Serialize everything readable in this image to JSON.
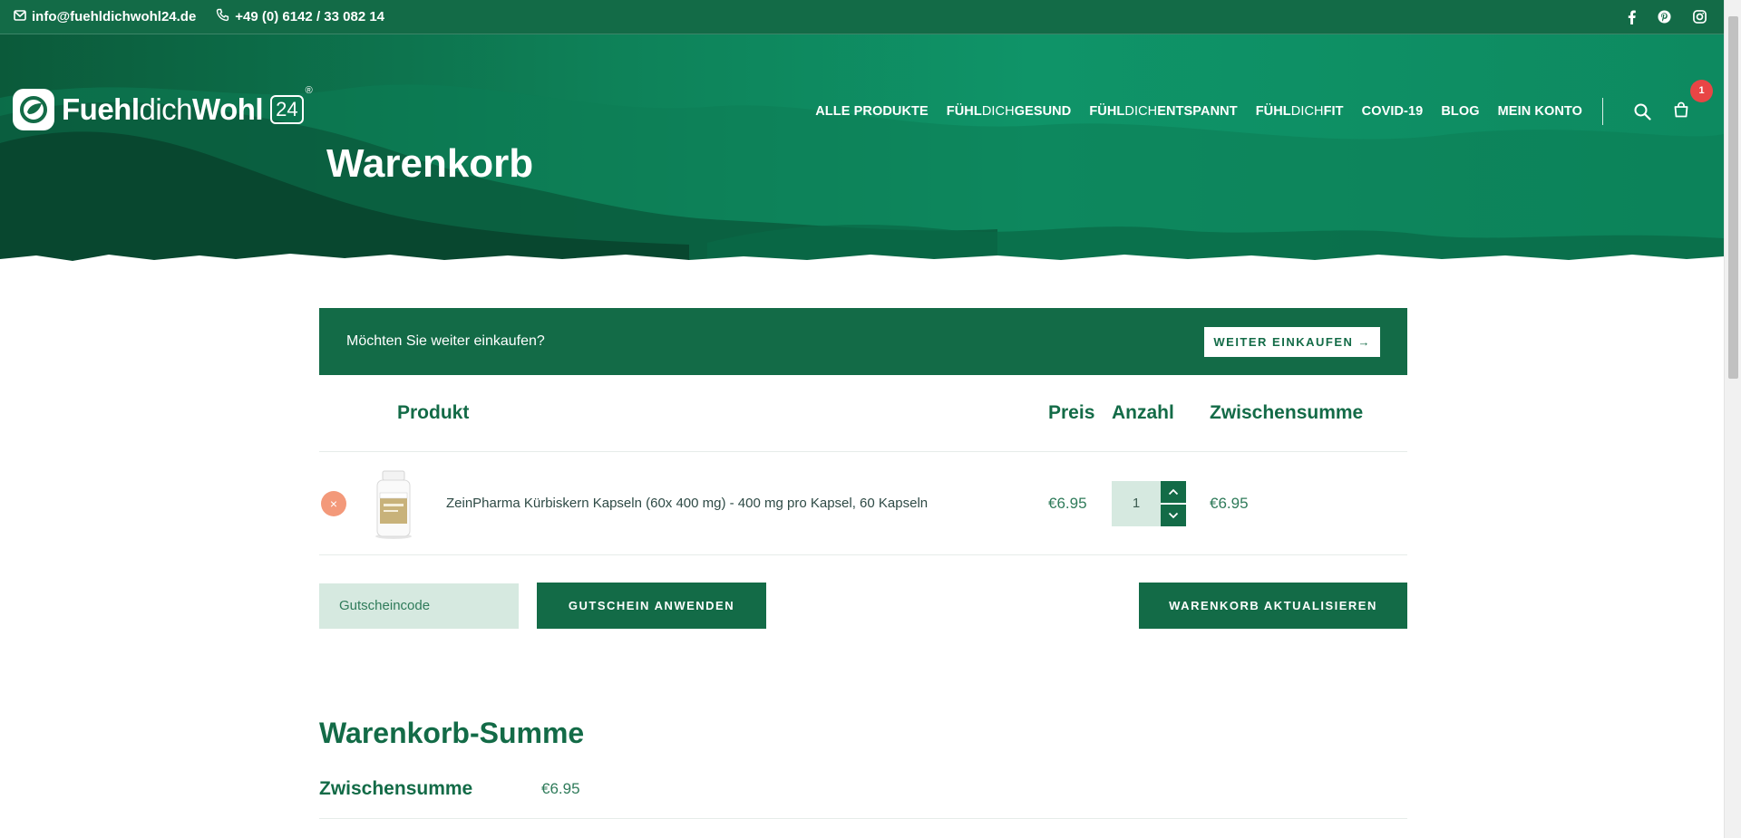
{
  "topbar": {
    "email": "info@fuehldichwohl24.de",
    "phone": "+49 (0) 6142 / 33 082 14",
    "social_icons": [
      "facebook-icon",
      "pinterest-icon",
      "instagram-icon"
    ]
  },
  "brand": {
    "name_bold_1": "Fuehl",
    "name_light": "dich",
    "name_bold_2": "Wohl",
    "badge": "24",
    "reg": "®"
  },
  "nav": {
    "items": [
      {
        "label": "ALLE PRODUKTE"
      },
      {
        "bold": "FÜHL",
        "thin": "DICH",
        "bold2": "GESUND"
      },
      {
        "bold": "FÜHL",
        "thin": "DICH",
        "bold2": "ENTSPANNT"
      },
      {
        "bold": "FÜHL",
        "thin": "DICH",
        "bold2": "FIT"
      },
      {
        "label": "COVID-19"
      },
      {
        "label": "BLOG"
      },
      {
        "label": "MEIN KONTO"
      }
    ],
    "cart_count": "1"
  },
  "page_title": "Warenkorb",
  "notice": {
    "text": "Möchten Sie weiter einkaufen?",
    "button": "WEITER EINKAUFEN →"
  },
  "cart": {
    "headers": {
      "product": "Produkt",
      "price": "Preis",
      "qty": "Anzahl",
      "subtotal": "Zwischensumme"
    },
    "items": [
      {
        "remove": "×",
        "name": "ZeinPharma Kürbiskern Kapseln (60x 400 mg) - 400 mg pro Kapsel, 60 Kapseln",
        "price": "€6.95",
        "qty": "1",
        "subtotal": "€6.95"
      }
    ],
    "coupon_placeholder": "Gutscheincode",
    "apply_label": "GUTSCHEIN ANWENDEN",
    "update_label": "WARENKORB AKTUALISIEREN"
  },
  "totals": {
    "title": "Warenkorb-Summe",
    "subtotal_label": "Zwischensumme",
    "subtotal_value": "€6.95"
  },
  "colors": {
    "brand_green": "#136b47",
    "light_green": "#d6e9e0",
    "remove_orange": "#f3997a",
    "badge_red": "#e84545"
  }
}
